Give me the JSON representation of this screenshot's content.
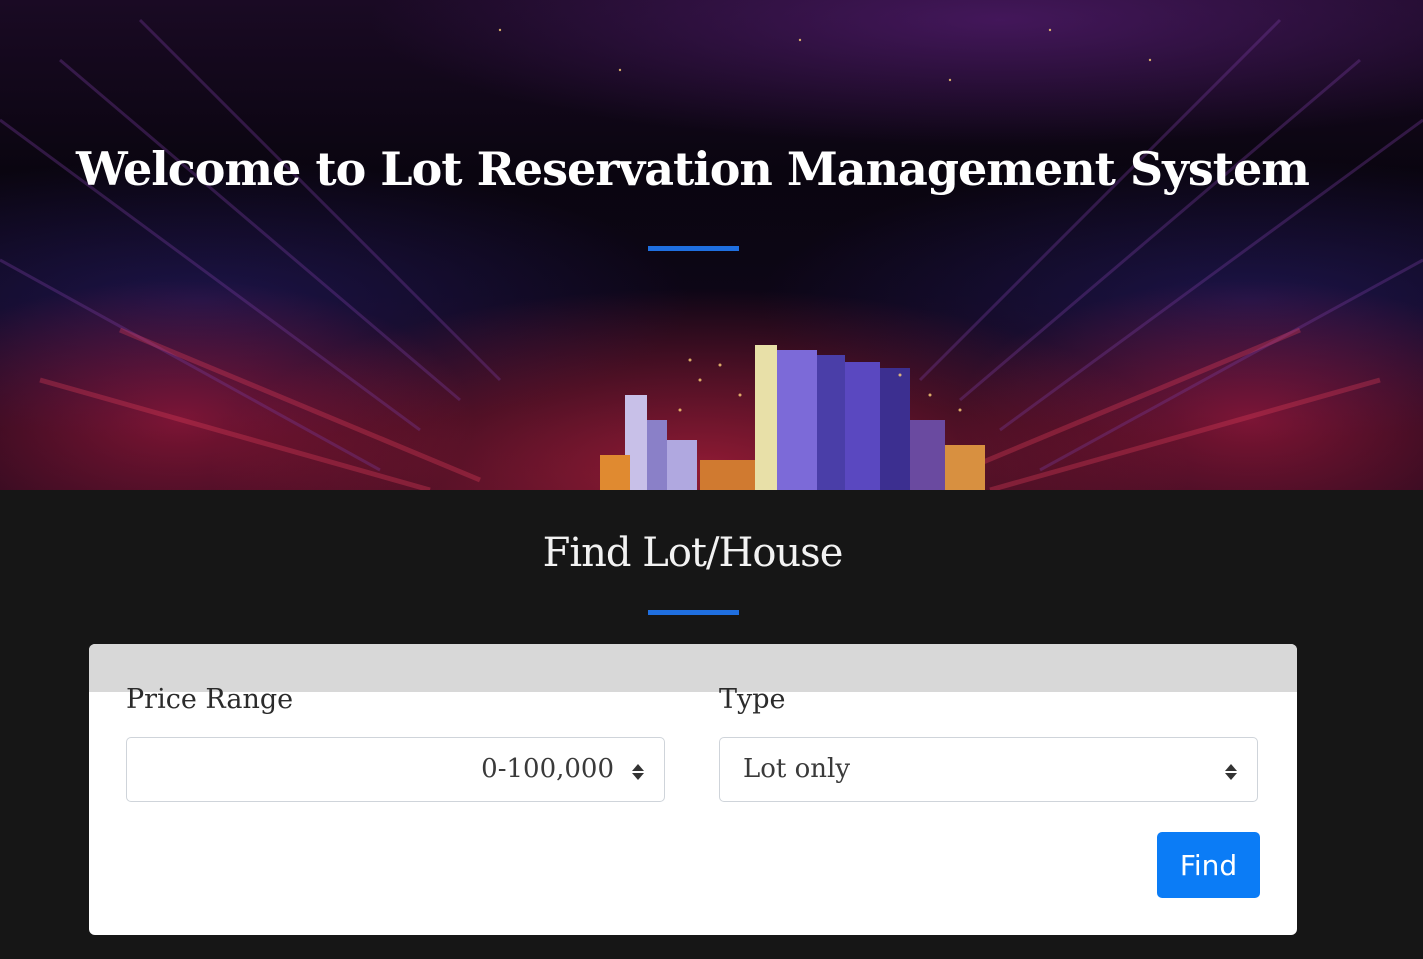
{
  "hero": {
    "title": "Welcome to Lot Reservation Management System",
    "accent_color": "#1f6fe0"
  },
  "search_section": {
    "title": "Find Lot/House",
    "price_range": {
      "label": "Price Range",
      "selected": "0-100,000",
      "icon": "sort-caret-icon"
    },
    "type": {
      "label": "Type",
      "selected": "Lot only",
      "icon": "sort-caret-icon"
    },
    "find_button": {
      "label": "Find",
      "color": "#0b7cf6"
    }
  }
}
